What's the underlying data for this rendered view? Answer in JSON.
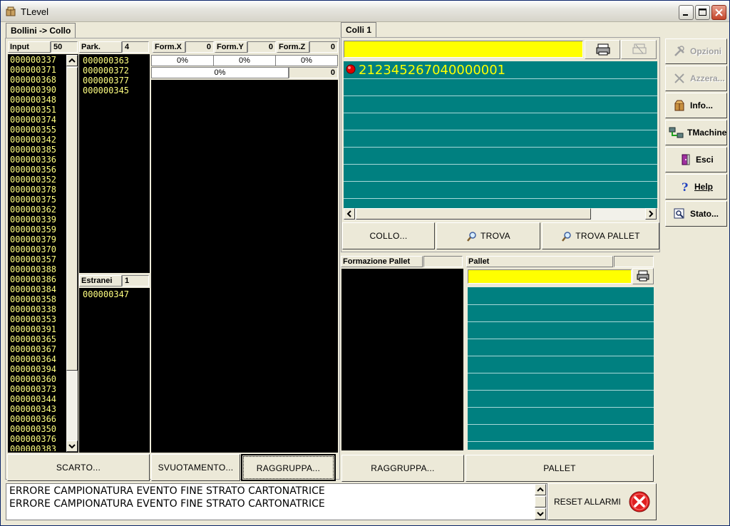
{
  "window": {
    "title": "TLevel"
  },
  "left_tab": {
    "label": "Bollini -> Collo"
  },
  "input_panel": {
    "header": "Input",
    "count": "50",
    "items": [
      "000000337",
      "000000371",
      "000000368",
      "000000390",
      "000000348",
      "000000351",
      "000000374",
      "000000355",
      "000000342",
      "000000385",
      "000000336",
      "000000356",
      "000000352",
      "000000378",
      "000000375",
      "000000362",
      "000000339",
      "000000359",
      "000000379",
      "000000370",
      "000000357",
      "000000388",
      "000000386",
      "000000384",
      "000000358",
      "000000338",
      "000000353",
      "000000391",
      "000000365",
      "000000367",
      "000000364",
      "000000394",
      "000000360",
      "000000373",
      "000000344",
      "000000343",
      "000000366",
      "000000350",
      "000000376",
      "000000383"
    ]
  },
  "park_panel": {
    "header": "Park.",
    "count": "4",
    "items": [
      "000000363",
      "000000372",
      "000000377",
      "000000345"
    ]
  },
  "estranei_panel": {
    "header": "Estranei",
    "count": "1",
    "items": [
      "000000347"
    ]
  },
  "formation": {
    "x_label": "Form.X",
    "x_value": "0",
    "y_label": "Form.Y",
    "y_value": "0",
    "z_label": "Form.Z",
    "z_value": "0",
    "x_progress": "0%",
    "y_progress": "0%",
    "z_progress": "0%",
    "total_progress": "0%",
    "total_value": "0"
  },
  "left_buttons": {
    "scarto": "SCARTO...",
    "svuotamento": "SVUOTAMENTO...",
    "raggruppa": "RAGGRUPPA..."
  },
  "colli": {
    "tab_label": "Colli 1",
    "barcode_value": "",
    "entries": [
      "212345267040000001"
    ],
    "buttons": {
      "collo": "COLLO...",
      "trova": "TROVA",
      "trova_pallet": "TROVA PALLET"
    }
  },
  "formazione_pallet": {
    "header": "Formazione Pallet",
    "header_value": ""
  },
  "pallet": {
    "header": "Pallet",
    "header_value": "",
    "barcode_value": ""
  },
  "bottom_buttons": {
    "raggruppa": "RAGGRUPPA...",
    "pallet": "PALLET"
  },
  "side_buttons": {
    "opzioni": "Opzioni",
    "azzera": "Azzera...",
    "info": "Info...",
    "tmachine": "TMachine",
    "esci": "Esci",
    "help": "Help",
    "stato": "Stato..."
  },
  "messages": {
    "lines": [
      "ERRORE CAMPIONATURA EVENTO FINE STRATO CARTONATRICE",
      "ERRORE CAMPIONATURA EVENTO FINE STRATO CARTONATRICE"
    ],
    "reset_label": "RESET ALLARMI"
  },
  "colors": {
    "teal": "#008080",
    "list_text": "#ffff80",
    "barcode_bg": "#ffff00",
    "entry_text": "#ffff00"
  }
}
